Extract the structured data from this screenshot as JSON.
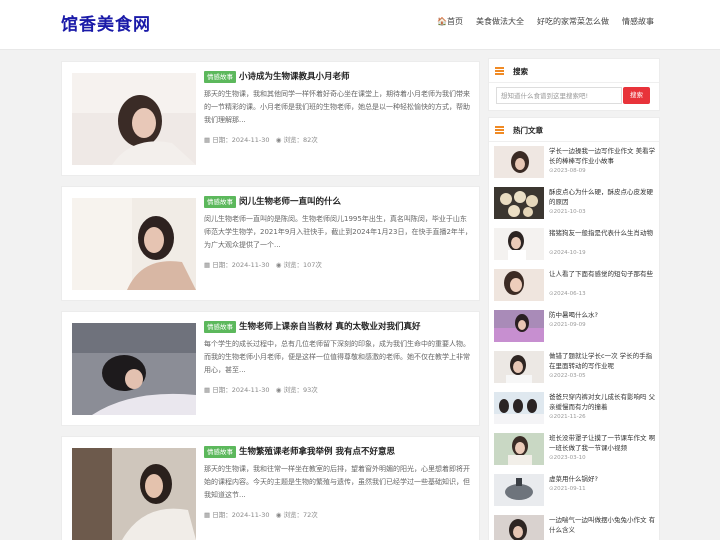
{
  "site": {
    "logo": "馆香美食网"
  },
  "nav": [
    {
      "label": "🏠首页"
    },
    {
      "label": "美食做法大全"
    },
    {
      "label": "好吃的家常菜怎么做"
    },
    {
      "label": "情感故事"
    }
  ],
  "posts": [
    {
      "tag": "情感故事",
      "title": "小诗成为生物课教具小月老师",
      "excerpt": "那天的生物课，我和其他同学一样怀着好奇心坐在课堂上，期待着小月老师为我们带来的一节精彩的课。小月老师是我们班的生物老师，她总是以一种轻松愉快的方式，帮助我们理解那...",
      "date": "日期：2024-11-30",
      "views": "浏览：82次"
    },
    {
      "tag": "情感故事",
      "title": "闵儿生物老师一直叫的什么",
      "excerpt": "闵儿生物老师一直叫的是陈闵。生物老师闵儿1995年出生，真名叫陈闵，毕业于山东师范大学生物学，2021年9月入驻快手，截止到2024年1月23日，在快手直播2年半，为广大观众提供了一个...",
      "date": "日期：2024-11-30",
      "views": "浏览：107次"
    },
    {
      "tag": "情感故事",
      "title": "生物老师上课亲自当教材 真的太敬业对我们真好",
      "excerpt": "每个学生的成长过程中，总有几位老师留下深刻的印象，成为我们生命中的重要人物。而我的生物老师小月老师，便是这样一位值得尊敬和感激的老师。她不仅在教学上非常用心，甚至...",
      "date": "日期：2024-11-30",
      "views": "浏览：93次"
    },
    {
      "tag": "情感故事",
      "title": "生物繁殖课老师拿我举例 我有点不好意思",
      "excerpt": "那天的生物课，我和往常一样坐在教室的后排，望着窗外明媚的阳光，心里想着即将开始的课程内容。今天的主题是生物的繁殖与遗传，虽然我们已经学过一些基础知识，但我知道这节...",
      "date": "日期：2024-11-30",
      "views": "浏览：72次"
    }
  ],
  "sidebar": {
    "search": {
      "heading": "搜索",
      "placeholder": "想知道什么食谱到这里搜索吧!",
      "button": "搜索"
    },
    "hot": {
      "heading": "热门文章",
      "items": [
        {
          "title": "学长一边操我一边写作业作文 美看学长的棒棒写作业小故事",
          "date": "2023-08-09"
        },
        {
          "title": "酥皮点心为什么硬，酥皮点心皮发硬的原因",
          "date": "2021-10-03"
        },
        {
          "title": "猪猪狗友一般指是代表什么生肖动物",
          "date": "2024-10-19"
        },
        {
          "title": "让人看了下面有感觉的短句子那有些",
          "date": "2024-06-13"
        },
        {
          "title": "防中暑喝什么水?",
          "date": "2021-09-09"
        },
        {
          "title": "做错了题就让学长c一次 学长的手指在里面转动的写作业呢",
          "date": "2022-03-05"
        },
        {
          "title": "爸爸只穿内裤对女儿成长有影响吗 父亲缓慢而有力的撞着",
          "date": "2021-11-26"
        },
        {
          "title": "班长没带罩子让摸了一节课车作文 啊一班长做了我一节课小视频",
          "date": "2023-03-10"
        },
        {
          "title": "虚菜用什么锅好?",
          "date": "2021-09-11"
        },
        {
          "title": "一边喘气一边叫做摆小兔兔小作文 有什么含义",
          "date": ""
        }
      ]
    }
  },
  "colors": {
    "logo": "#1a1aa8",
    "tag": "#5cb85c",
    "accent_icon": "#f08a24",
    "search_button": "#e8333a"
  }
}
